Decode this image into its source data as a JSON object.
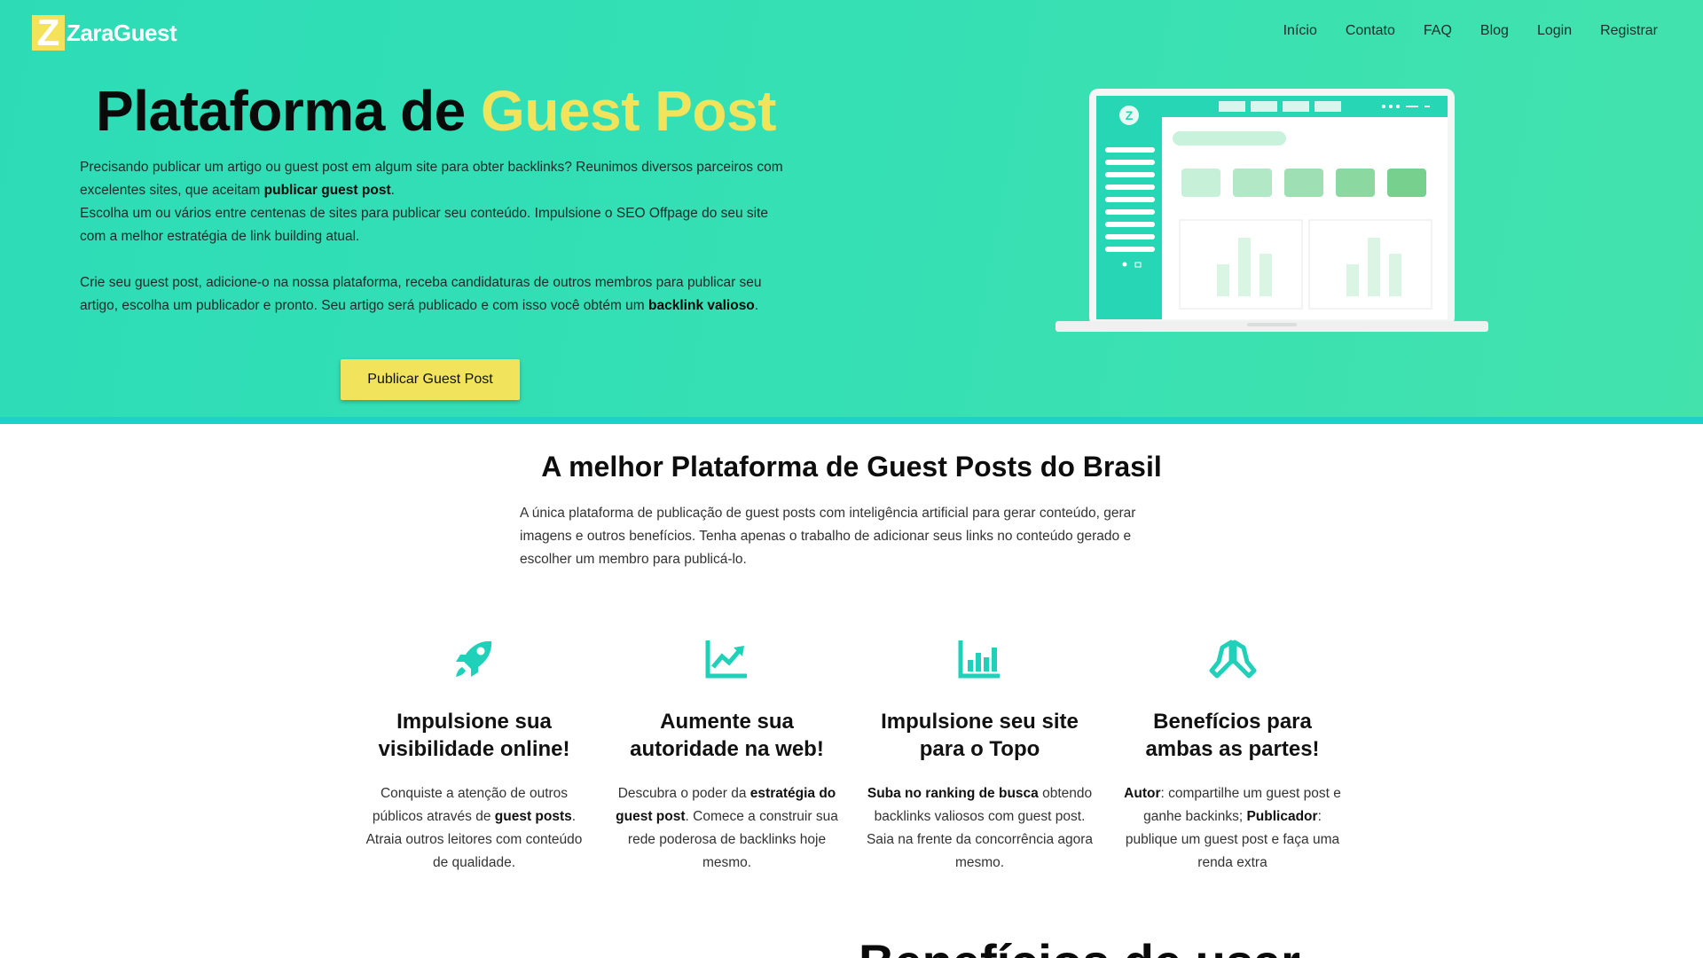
{
  "brand": {
    "name": "ZaraGuest",
    "mark_letter": "Z",
    "accent_color": "#f2e35c",
    "primary_color": "#2ddcb7"
  },
  "nav": {
    "items": [
      "Início",
      "Contato",
      "FAQ",
      "Blog",
      "Login",
      "Registrar"
    ]
  },
  "hero": {
    "title_main": "Plataforma de ",
    "title_accent": "Guest Post",
    "p1_a": "Precisando publicar um artigo ou guest post em algum site para obter backlinks? Reunimos diversos parceiros com excelentes sites, que aceitam ",
    "p1_bold": "publicar guest post",
    "p1_b": ".",
    "p1_c": "Escolha um ou vários entre centenas de sites para publicar seu conteúdo. Impulsione o SEO Offpage do seu site com a melhor estratégia de link building atual.",
    "p2_a": "Crie seu guest post, adicione-o na nossa plataforma, receba candidaturas de outros membros para publicar seu artigo, escolha um publicador e pronto. Seu artigo será publicado e com isso você obtém um ",
    "p2_bold": "backlink valioso",
    "p2_b": ".",
    "cta_label": "Publicar Guest Post",
    "illustration_logo_letter": "Z"
  },
  "section": {
    "title": "A melhor Plataforma de Guest Posts do Brasil",
    "description": "A única plataforma de publicação de guest posts com inteligência artificial para gerar conteúdo, gerar imagens e outros benefícios. Tenha apenas o trabalho de adicionar seus links no conteúdo gerado e escolher um membro para publicá-lo."
  },
  "features": [
    {
      "icon": "rocket-icon",
      "title_line1": "Impulsione sua",
      "title_line2": "visibilidade online!",
      "text_a": "Conquiste a atenção de outros públicos através de ",
      "text_bold": "guest posts",
      "text_b": ". Atraia outros leitores com conteúdo de qualidade."
    },
    {
      "icon": "trend-up-icon",
      "title_line1": "Aumente sua",
      "title_line2": "autoridade na web!",
      "text_a": "Descubra o poder da ",
      "text_bold": "estratégia do guest post",
      "text_b": ". Comece a construir sua rede poderosa de backlinks hoje mesmo."
    },
    {
      "icon": "bar-chart-icon",
      "title_line1": "Impulsione seu site",
      "title_line2": "para o Topo",
      "text_bold": "Suba no ranking de busca",
      "text_b": " obtendo backlinks valiosos com guest post. Saia na frente da concorrência agora mesmo."
    },
    {
      "icon": "praying-hands-icon",
      "title_line1": "Benefícios para",
      "title_line2": "ambas as partes!",
      "bold1": "Autor",
      "text1": ": compartilhe um guest post e ganhe backinks; ",
      "bold2": "Publicador",
      "text2": ": publique um guest post e faça uma renda extra"
    }
  ],
  "next_section": {
    "title_partial": "Benefícios de usar"
  },
  "colors": {
    "icon_teal": "#1fd1b8",
    "cta_yellow": "#f1e35b"
  }
}
